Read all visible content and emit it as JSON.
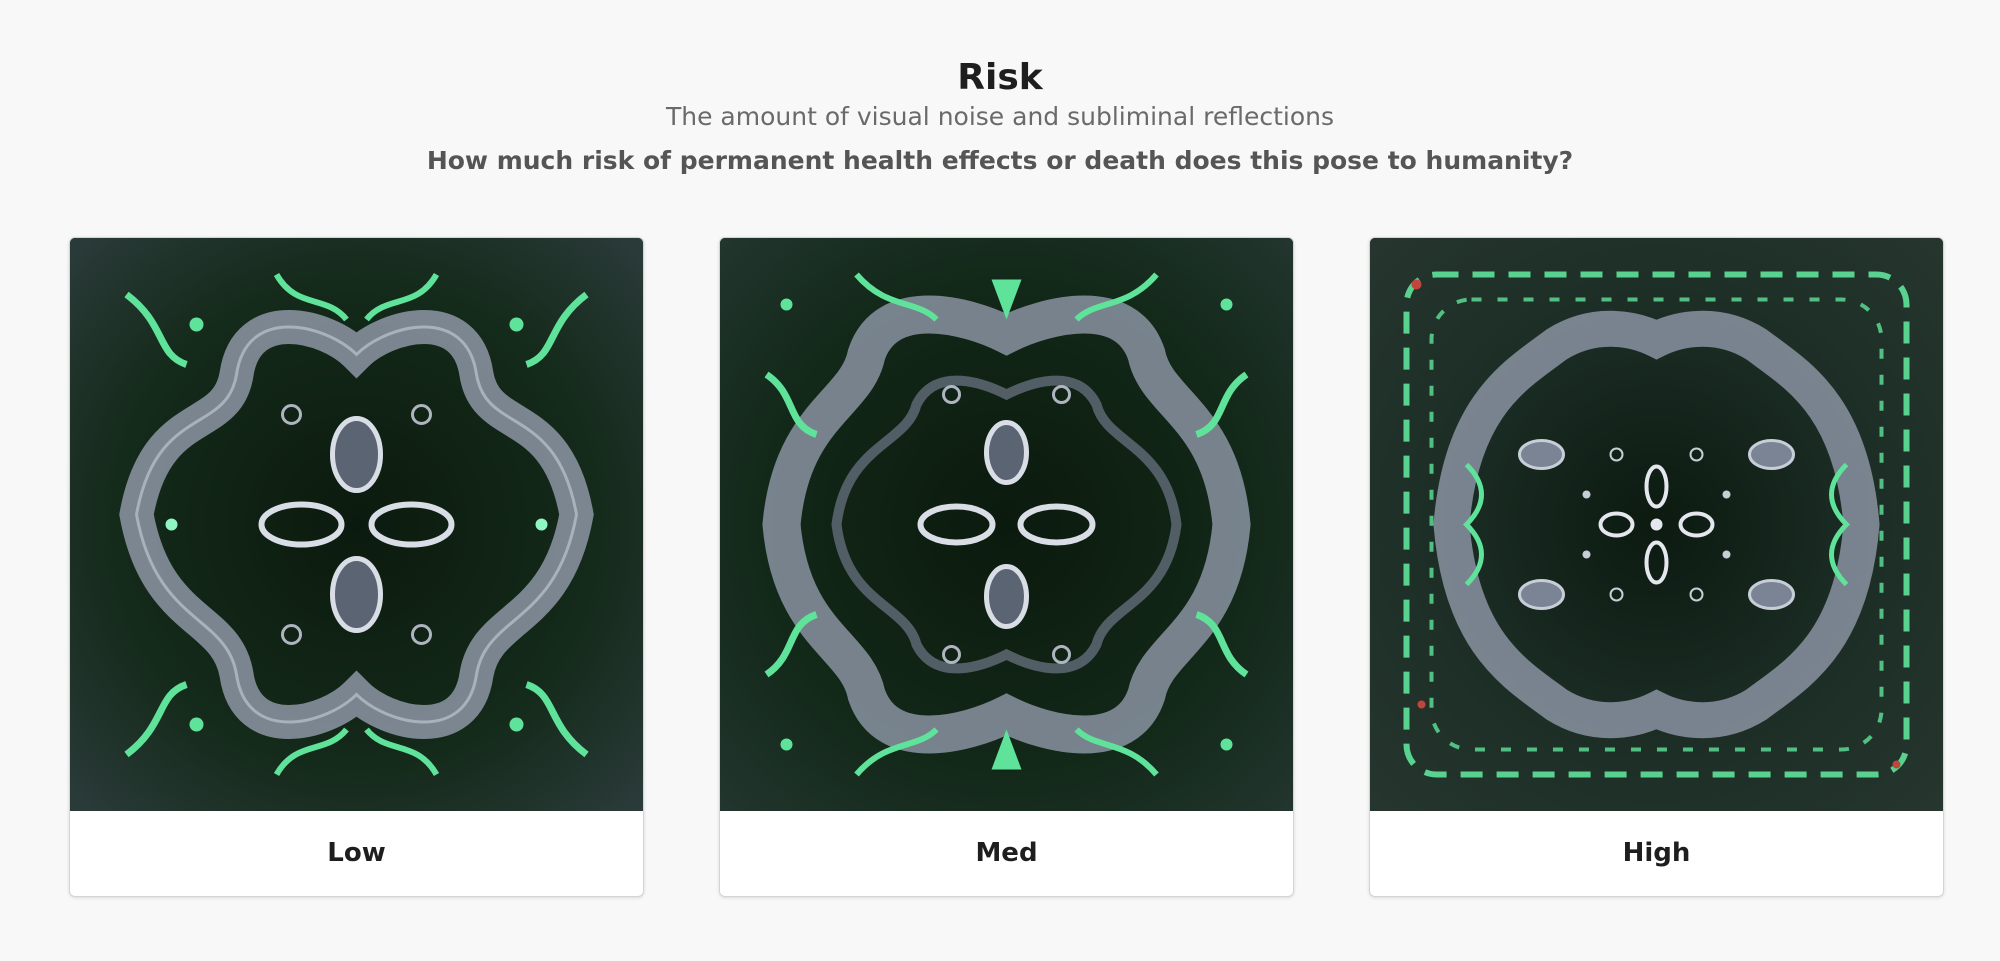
{
  "header": {
    "title": "Risk",
    "subtitle": "The amount of visual noise and subliminal reflections",
    "question": "How much risk of permanent health effects or death does this pose to humanity?"
  },
  "options": [
    {
      "label": "Low"
    },
    {
      "label": "Med"
    },
    {
      "label": "High"
    }
  ],
  "colors": {
    "background": "#f8f8f8",
    "art_dark": "#0f1c12",
    "art_green": "#5fe39a",
    "art_silver": "#8e97a6"
  }
}
